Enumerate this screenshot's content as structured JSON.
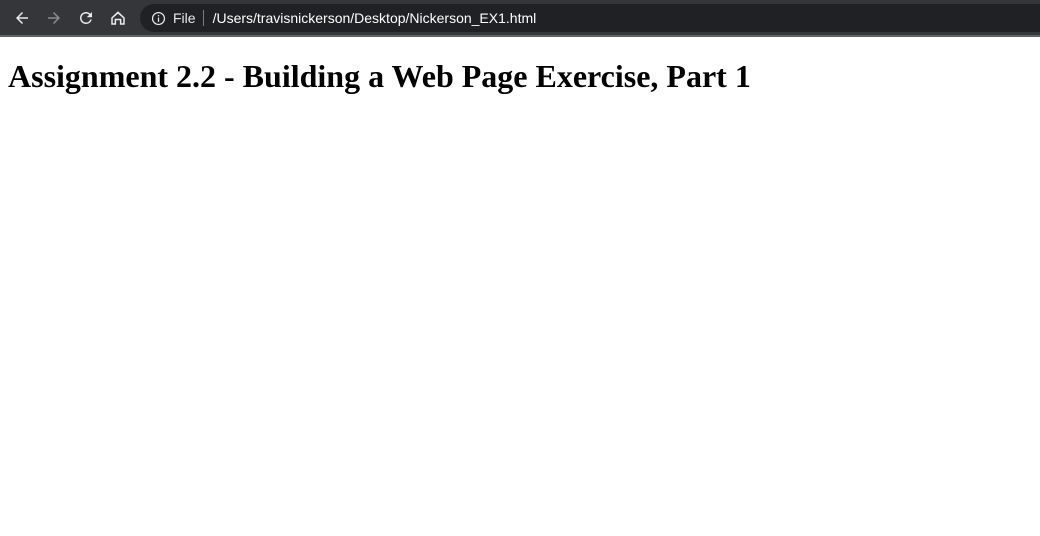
{
  "browser": {
    "toolbar": {
      "back_icon": "arrow-left-icon",
      "forward_icon": "arrow-right-icon",
      "reload_icon": "reload-icon",
      "home_icon": "home-icon"
    },
    "omnibox": {
      "site_info_icon": "info-circle-icon",
      "scheme_label": "File",
      "url": "/Users/travisnickerson/Desktop/Nickerson_EX1.html"
    },
    "colors": {
      "toolbar_bg": "#35363a",
      "omnibox_bg": "#202124",
      "icon_active": "#e8eaed",
      "icon_disabled": "#8a8b8f"
    }
  },
  "page": {
    "heading": "Assignment 2.2 - Building a Web Page Exercise, Part 1"
  }
}
